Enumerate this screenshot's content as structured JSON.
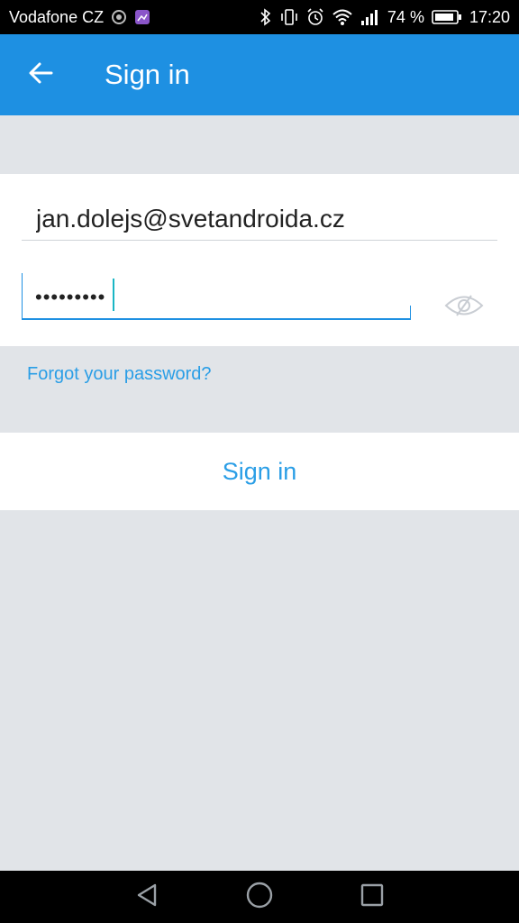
{
  "status_bar": {
    "carrier": "Vodafone CZ",
    "battery": "74 %",
    "time": "17:20",
    "icons": [
      "sync-icon",
      "image-icon",
      "bluetooth-icon",
      "vibrate-icon",
      "alarm-icon",
      "wifi-icon",
      "signal-icon",
      "battery-icon"
    ]
  },
  "app_bar": {
    "title": "Sign in",
    "back_icon": "arrow-left-icon"
  },
  "form": {
    "email_value": "jan.dolejs@svetandroida.cz",
    "password_masked": "•••••••••",
    "password_toggle_icon": "eye-off-icon"
  },
  "forgot_link": "Forgot your password?",
  "signin_button": "Sign in",
  "nav_bar": {
    "icons": [
      "back-triangle-icon",
      "home-circle-icon",
      "recents-square-icon"
    ]
  },
  "colors": {
    "accent": "#1e90e2",
    "link": "#2a9ee6",
    "background": "#e1e4e8",
    "cursor": "#1ab6c5"
  }
}
